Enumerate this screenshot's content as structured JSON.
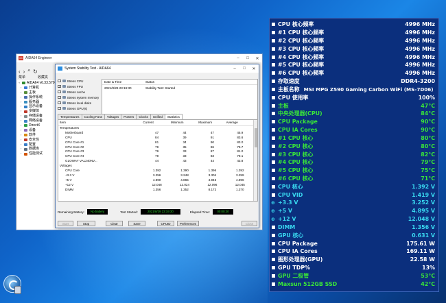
{
  "aida_window": {
    "title": "AIDA64 Engineer",
    "menu": [
      "菜单",
      "收藏夹"
    ],
    "version_label": "AIDA64 v6.33.5700",
    "tree": [
      {
        "label": "计算机",
        "root": false
      },
      {
        "label": "主板",
        "root": false
      },
      {
        "label": "操作系统",
        "root": false
      },
      {
        "label": "服务器",
        "root": false
      },
      {
        "label": "显示设备",
        "root": false
      },
      {
        "label": "多媒体",
        "root": false
      },
      {
        "label": "存储设备",
        "root": false
      },
      {
        "label": "网络设备",
        "root": false
      },
      {
        "label": "DirectX",
        "root": false
      },
      {
        "label": "设备",
        "root": false
      },
      {
        "label": "软件",
        "root": false
      },
      {
        "label": "安全性",
        "root": false
      },
      {
        "label": "配置",
        "root": false
      },
      {
        "label": "数据库",
        "root": false
      },
      {
        "label": "性能测试",
        "root": false
      }
    ]
  },
  "stability": {
    "title": "System Stability Test - AIDA64",
    "stress_options": [
      {
        "label": "Stress CPU",
        "checked": false
      },
      {
        "label": "Stress FPU",
        "checked": true
      },
      {
        "label": "Stress cache",
        "checked": false
      },
      {
        "label": "Stress system memory",
        "checked": false
      },
      {
        "label": "Stress local disks",
        "checked": false
      },
      {
        "label": "Stress GPU(s)",
        "checked": false
      }
    ],
    "log_headers": [
      "Date & Time",
      "Status"
    ],
    "log_rows": [
      {
        "time": "2021/8/29 23:19:30",
        "status": "Stability Test: Started"
      }
    ],
    "tabs": [
      "Temperatures",
      "Cooling Fans",
      "Voltages",
      "Powers",
      "Clocks",
      "Unified",
      "Statistics"
    ],
    "active_tab": "Statistics",
    "stats_headers": [
      "Item",
      "Current",
      "Minimum",
      "Maximum",
      "Average"
    ],
    "stats_rows": [
      {
        "name": "Temperatures",
        "group": true,
        "cur": "",
        "min": "",
        "max": "",
        "avg": ""
      },
      {
        "name": "Motherboard",
        "group": false,
        "cur": "47",
        "min": "44",
        "max": "47",
        "avg": "45.9"
      },
      {
        "name": "CPU",
        "group": false,
        "cur": "84",
        "min": "39",
        "max": "91",
        "avg": "83.6"
      },
      {
        "name": "CPU Core #1",
        "group": false,
        "cur": "81",
        "min": "34",
        "max": "90",
        "avg": "83.0"
      },
      {
        "name": "CPU Core #2",
        "group": false,
        "cur": "79",
        "min": "35",
        "max": "86",
        "avg": "79.7"
      },
      {
        "name": "CPU Core #3",
        "group": false,
        "cur": "79",
        "min": "33",
        "max": "87",
        "avg": "81.0"
      },
      {
        "name": "CPU Core #4",
        "group": false,
        "cur": "79",
        "min": "33",
        "max": "83",
        "avg": "79.1"
      },
      {
        "name": "GLOWAY VAL240NV...",
        "group": false,
        "cur": "44",
        "min": "43",
        "max": "44",
        "avg": "43.8"
      },
      {
        "name": "Voltages",
        "group": true,
        "cur": "",
        "min": "",
        "max": "",
        "avg": ""
      },
      {
        "name": "CPU Core",
        "group": false,
        "cur": "1.392",
        "min": "1.390",
        "max": "1.396",
        "avg": "1.392"
      },
      {
        "name": "+3.3 V",
        "group": false,
        "cur": "3.256",
        "min": "3.248",
        "max": "3.304",
        "avg": "3.259"
      },
      {
        "name": "+5 V",
        "group": false,
        "cur": "4.890",
        "min": "4.865",
        "max": "4.945",
        "avg": "4.896"
      },
      {
        "name": "+12 V",
        "group": false,
        "cur": "12.048",
        "min": "12.024",
        "max": "12.096",
        "avg": "12.045"
      },
      {
        "name": "DIMM",
        "group": false,
        "cur": "1.356",
        "min": "1.352",
        "max": "8.172",
        "avg": "1.370"
      }
    ],
    "remaining_battery_label": "Remaining Battery:",
    "remaining_battery": "No battery",
    "test_started_label": "Test Started:",
    "test_started": "2021/8/29 23:19:30",
    "elapsed_label": "Elapsed Time:",
    "elapsed": "00:00:20",
    "buttons": {
      "start": "Start",
      "stop": "Stop",
      "clear": "Clear",
      "save": "Save",
      "cpuid": "CPUID",
      "preferences": "Preferences",
      "close": "Close"
    }
  },
  "osd": {
    "rows": [
      {
        "label": "CPU 核心频率",
        "value": "4996 MHz",
        "color": "#ffffff",
        "marker": true
      },
      {
        "label": "#1 CPU 核心频率",
        "value": "4996 MHz",
        "color": "#ffffff",
        "marker": true
      },
      {
        "label": "#2 CPU 核心频率",
        "value": "4996 MHz",
        "color": "#ffffff",
        "marker": true
      },
      {
        "label": "#3 CPU 核心频率",
        "value": "4996 MHz",
        "color": "#ffffff",
        "marker": true
      },
      {
        "label": "#4 CPU 核心频率",
        "value": "4996 MHz",
        "color": "#ffffff",
        "marker": true
      },
      {
        "label": "#5 CPU 核心频率",
        "value": "4996 MHz",
        "color": "#ffffff",
        "marker": true
      },
      {
        "label": "#6 CPU 核心频率",
        "value": "4996 MHz",
        "color": "#ffffff",
        "marker": true
      },
      {
        "label": "存取速度",
        "value": "DDR4-3200",
        "color": "#ffffff",
        "marker": true
      },
      {
        "label": "主板名称",
        "value": "MSI MPG Z590 Gaming Carbon WiFi (MS-7D06)",
        "color": "#ffffff",
        "marker": true,
        "inline": true
      },
      {
        "label": "CPU 使用率",
        "value": "100%",
        "color": "#ffffff",
        "marker": true
      },
      {
        "label": "主板",
        "value": "47°C",
        "color": "#39e639",
        "marker": true
      },
      {
        "label": "中央处理器(CPU)",
        "value": "84°C",
        "color": "#39e639",
        "marker": true
      },
      {
        "label": "CPU Package",
        "value": "90°C",
        "color": "#39e639",
        "marker": true
      },
      {
        "label": "CPU IA Cores",
        "value": "90°C",
        "color": "#39e639",
        "marker": true
      },
      {
        "label": "#1 CPU 核心",
        "value": "80°C",
        "color": "#39e639",
        "marker": true
      },
      {
        "label": "#2 CPU 核心",
        "value": "80°C",
        "color": "#39e639",
        "marker": true
      },
      {
        "label": "#3 CPU 核心",
        "value": "82°C",
        "color": "#39e639",
        "marker": true
      },
      {
        "label": "#4 CPU 核心",
        "value": "79°C",
        "color": "#39e639",
        "marker": true
      },
      {
        "label": "#5 CPU 核心",
        "value": "75°C",
        "color": "#39e639",
        "marker": true
      },
      {
        "label": "#6 CPU 核心",
        "value": "71°C",
        "color": "#39e639",
        "marker": true
      },
      {
        "label": "CPU 核心",
        "value": "1.392 V",
        "color": "#39d8f0",
        "marker": true
      },
      {
        "label": "CPU VID",
        "value": "1.419 V",
        "color": "#39d8f0",
        "marker": true
      },
      {
        "label": "+3.3 V",
        "value": "3.252 V",
        "color": "#39d8f0",
        "marker": true,
        "bullet": "⊕"
      },
      {
        "label": "+5 V",
        "value": "4.895 V",
        "color": "#39d8f0",
        "marker": true,
        "bullet": "⊕"
      },
      {
        "label": "+12 V",
        "value": "12.048 V",
        "color": "#39d8f0",
        "marker": true,
        "bullet": "⊕"
      },
      {
        "label": "DIMM",
        "value": "1.356 V",
        "color": "#39d8f0",
        "marker": true
      },
      {
        "label": "GPU 核心",
        "value": "0.631 V",
        "color": "#39d8f0",
        "marker": true
      },
      {
        "label": "CPU Package",
        "value": "175.61 W",
        "color": "#ffffff",
        "marker": true
      },
      {
        "label": "CPU IA Cores",
        "value": "169.11 W",
        "color": "#ffffff",
        "marker": true
      },
      {
        "label": "图形处理器(GPU)",
        "value": "22.58 W",
        "color": "#ffffff",
        "marker": true
      },
      {
        "label": "GPU TDP%",
        "value": "13%",
        "color": "#ffffff",
        "marker": true
      },
      {
        "label": "GPU 二极管",
        "value": "53°C",
        "color": "#39e639",
        "marker": true
      },
      {
        "label": "Maxsun 512GB SSD",
        "value": "42°C",
        "color": "#39e639",
        "marker": true
      }
    ]
  }
}
